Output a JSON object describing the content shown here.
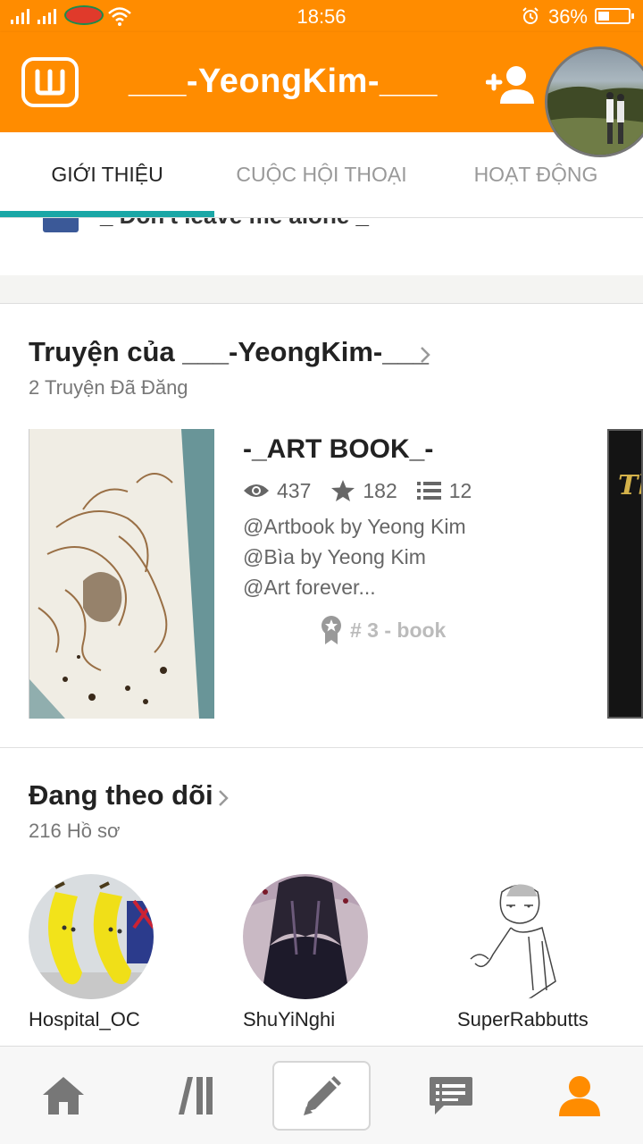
{
  "status_bar": {
    "carrier": "VIETTEL",
    "time": "18:56",
    "battery_percent": "36%",
    "battery_level": 0.36
  },
  "header": {
    "profile_name": "___-YeongKim-___"
  },
  "tabs": [
    {
      "label": "GIỚI THIỆU",
      "active": true
    },
    {
      "label": "CUỘC HỘI THOẠI",
      "active": false
    },
    {
      "label": "HOẠT ĐỘNG",
      "active": false
    }
  ],
  "about": {
    "remnant_text": "_ Don't leave me alone _"
  },
  "stories": {
    "title": "Truyện của ___-YeongKim-___",
    "subtitle": "2 Truyện Đã Đăng",
    "items": [
      {
        "title": "-_ART BOOK_-",
        "views": "437",
        "votes": "182",
        "parts": "12",
        "description_lines": [
          "@Artbook by Yeong Kim",
          "@Bìa by Yeong Kim",
          "@Art forever..."
        ],
        "rank": "# 3 - book"
      }
    ],
    "next_cover_text": "Th"
  },
  "following": {
    "title": "Đang theo dõi",
    "subtitle": "216 Hồ sơ",
    "profiles": [
      {
        "name": "Hospital_OC"
      },
      {
        "name": "ShuYiNghi"
      },
      {
        "name": "SuperRabbutts"
      }
    ]
  },
  "bottom_nav": {
    "items": [
      "home-icon",
      "library-icon",
      "write-icon",
      "messages-icon",
      "profile-icon"
    ],
    "active_index": 4
  },
  "colors": {
    "brand_orange": "#ff8c00",
    "tab_indicator": "#1aa7a6",
    "text_dark": "#222222",
    "text_muted": "#777777"
  }
}
